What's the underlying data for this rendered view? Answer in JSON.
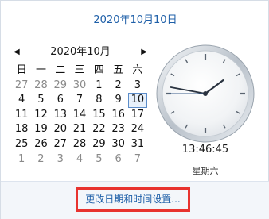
{
  "header": {
    "date_text": "2020年10月10日"
  },
  "calendar": {
    "prev_icon": "triangle-left",
    "next_icon": "triangle-right",
    "month_title": "2020年10月",
    "weekday_headers": [
      "日",
      "一",
      "二",
      "三",
      "四",
      "五",
      "六"
    ],
    "weeks": [
      [
        "27",
        "28",
        "29",
        "30",
        "1",
        "2",
        "3"
      ],
      [
        "4",
        "5",
        "6",
        "7",
        "8",
        "9",
        "10"
      ],
      [
        "11",
        "12",
        "13",
        "14",
        "15",
        "16",
        "17"
      ],
      [
        "18",
        "19",
        "20",
        "21",
        "22",
        "23",
        "24"
      ],
      [
        "25",
        "26",
        "27",
        "28",
        "29",
        "30",
        "31"
      ],
      [
        "1",
        "2",
        "3",
        "4",
        "5",
        "6",
        "7"
      ]
    ],
    "selected_day": "10"
  },
  "clock": {
    "time_text": "13:46:45",
    "weekday_text": "星期六"
  },
  "footer": {
    "change_link": "更改日期和时间设置..."
  },
  "colors": {
    "link": "#1e5fa8",
    "highlight_border": "#e8332f",
    "selected_border": "#5b8cc9"
  }
}
